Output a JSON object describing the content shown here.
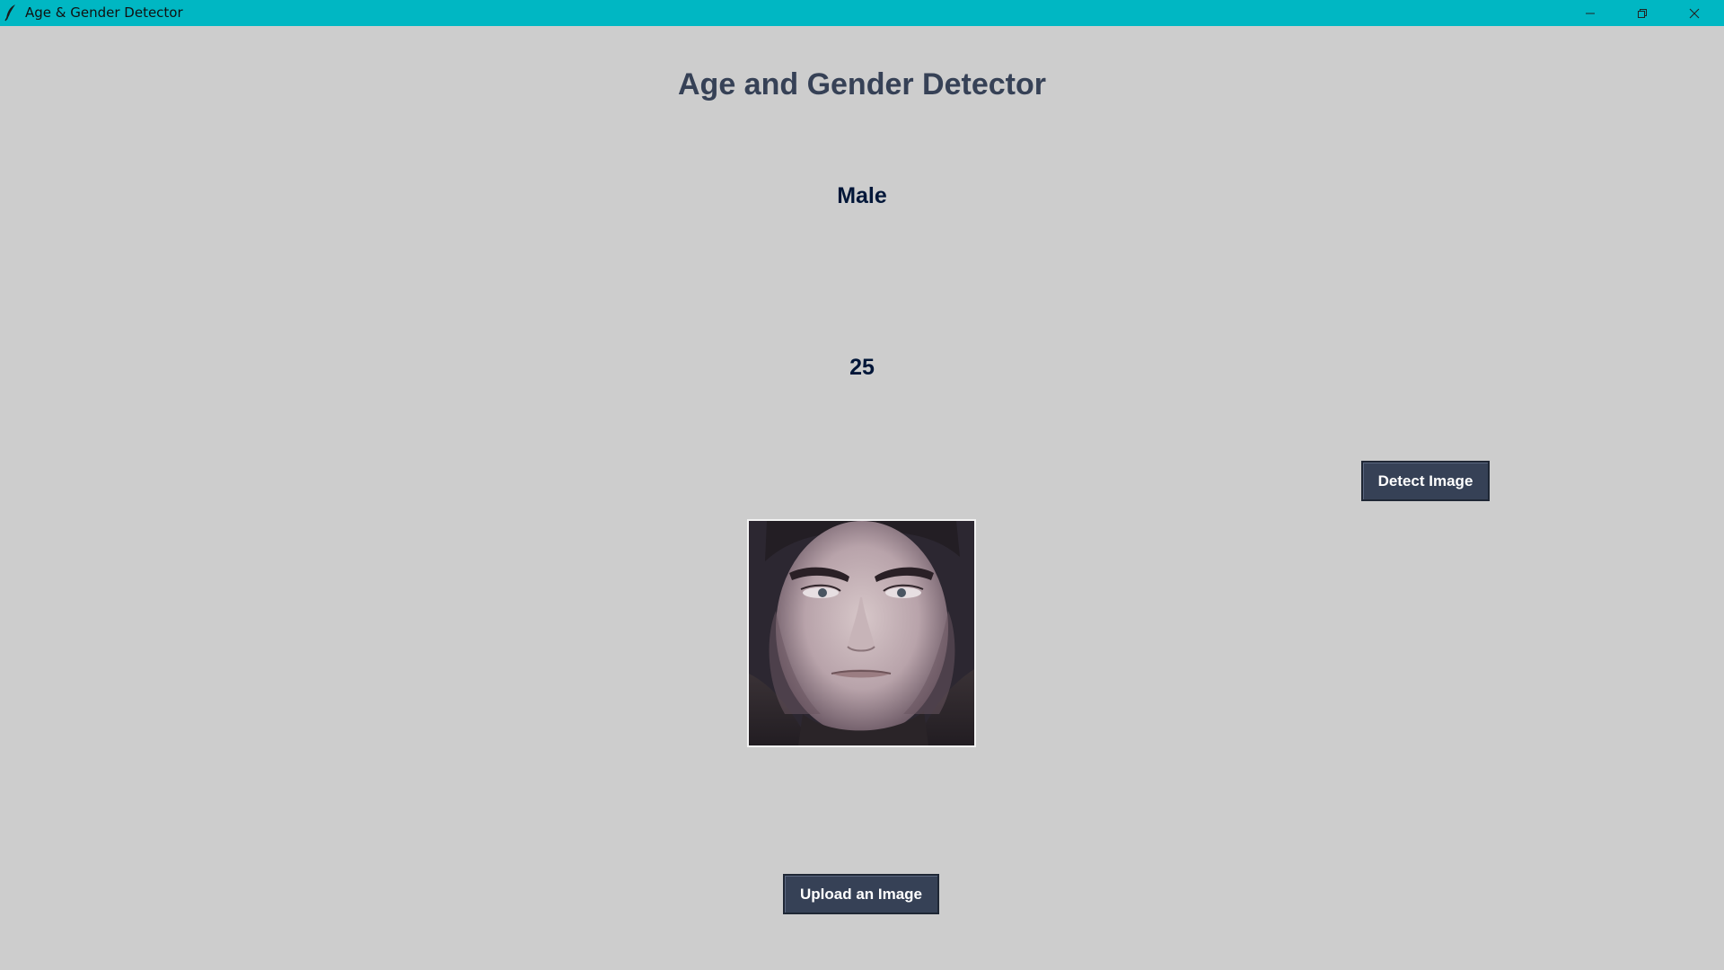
{
  "window": {
    "title": "Age & Gender Detector",
    "icon": "feather-icon",
    "controls": [
      "minimize-icon",
      "restore-icon",
      "close-icon"
    ]
  },
  "app": {
    "heading": "Age and Gender Detector",
    "gender_result": "Male",
    "age_result": "25",
    "detect_button_label": "Detect Image",
    "upload_button_label": "Upload an Image",
    "photo": "face-photo"
  },
  "colors": {
    "titlebar": "#00b7c3",
    "background": "#cdcdcd",
    "heading": "#364156",
    "result_text": "#011638",
    "button_bg": "#364156",
    "button_text": "#ffffff"
  }
}
